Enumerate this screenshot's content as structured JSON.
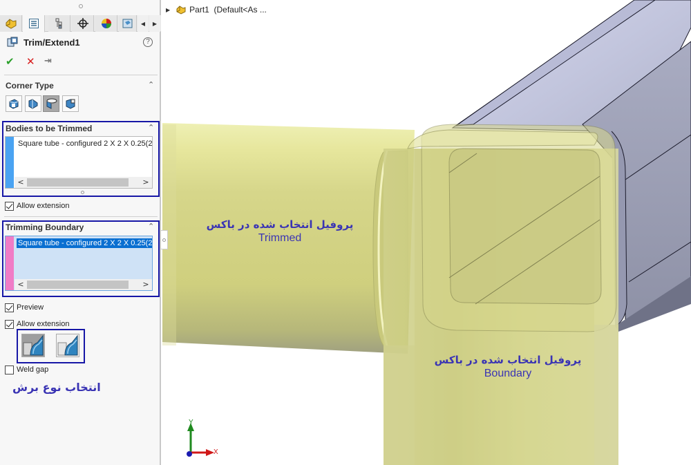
{
  "panel": {
    "tabs": [
      {
        "name": "feature-manager",
        "icon": "part-icon"
      },
      {
        "name": "property-manager",
        "icon": "property-list-icon",
        "active": true
      },
      {
        "name": "configuration-manager",
        "icon": "configuration-icon"
      },
      {
        "name": "dimxpert-manager",
        "icon": "crosshair-icon"
      },
      {
        "name": "display-manager",
        "icon": "appearance-icon"
      },
      {
        "name": "cam-manager",
        "icon": "cam-icon"
      }
    ],
    "title": "Trim/Extend1",
    "help_symbol": "?",
    "actions": {
      "ok": "✔",
      "cancel": "✕",
      "pin": "⇥"
    },
    "corner_type": {
      "title": "Corner Type",
      "options": [
        "end-trim",
        "end-miter",
        "end-butt1",
        "end-butt2"
      ],
      "selected_index": 2
    },
    "bodies_to_be_trimmed": {
      "title": "Bodies to be Trimmed",
      "items": [
        "Square tube - configured 2 X 2 X 0.25(2"
      ],
      "color": "#4aa3f2"
    },
    "allow_extension_1": {
      "label": "Allow extension",
      "checked": true
    },
    "trimming_boundary": {
      "title": "Trimming Boundary",
      "items": [
        "Square tube - configured 2 X 2 X 0.25(2"
      ],
      "color": "#f07cc6",
      "selected_index": 0
    },
    "preview": {
      "label": "Preview",
      "checked": true
    },
    "allow_extension_2": {
      "label": "Allow extension",
      "checked": true
    },
    "trim_type": {
      "options": [
        "body-trim",
        "planar-trim"
      ],
      "selected_index": 0
    },
    "weld_gap": {
      "label": "Weld gap",
      "checked": false
    },
    "annotation_trim_type": "انتخاب نوع برش"
  },
  "viewport": {
    "tree_root": "Part1  (Default<As ...",
    "annotation_trimmed": {
      "fa": "پروفیل انتخاب شده در باکس",
      "en": "Trimmed"
    },
    "annotation_boundary": {
      "fa": "پروفیل انتخاب شده در باکس",
      "en": "Boundary"
    },
    "triad": {
      "x": "X",
      "y": "Y"
    }
  },
  "colors": {
    "annotation": "#3a34b4",
    "highlight_box": "#1616a6",
    "tube_yellow": "#d8d98a",
    "tube_blue": "#c4c7df"
  }
}
